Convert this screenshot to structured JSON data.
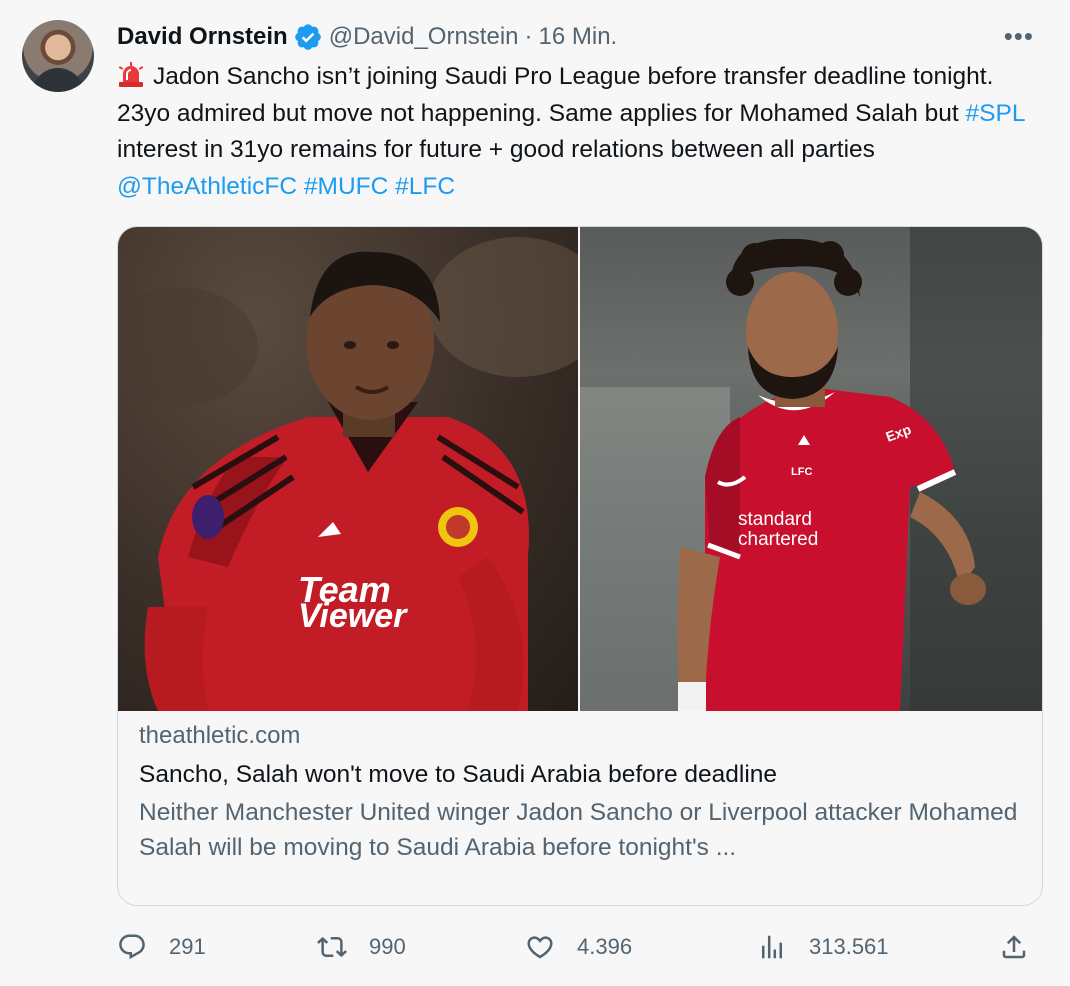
{
  "author": {
    "name": "David Ornstein",
    "handle": "@David_Ornstein",
    "separator": "·",
    "time": "16 Min."
  },
  "menu": {
    "more_label": "•••"
  },
  "tweet": {
    "emoji_icon": "siren-icon",
    "text_part1": "Jadon Sancho isn’t joining Saudi Pro League before transfer deadline tonight. 23yo admired but move not happening. Same applies for Mohamed Salah but ",
    "hashtag_spl": "#SPL",
    "text_part2": " interest in 31yo remains for future + good relations between all parties ",
    "mention": "@TheAthleticFC",
    "hashtag_mufc": "#MUFC",
    "hashtag_lfc": "#LFC"
  },
  "card": {
    "domain": "theathletic.com",
    "title": "Sancho, Salah won't move to Saudi Arabia before deadline",
    "description": "Neither Manchester United winger Jadon Sancho or Liverpool attacker Mohamed Salah will be moving to Saudi Arabia before tonight's ...",
    "left_photo": {
      "shirt_sponsor_line1": "Team",
      "shirt_sponsor_line2": "Viewer",
      "accent": "#b3161f"
    },
    "right_photo": {
      "shirt_sponsor_line1": "standard",
      "shirt_sponsor_line2": "chartered",
      "crest_text": "LFC",
      "sleeve_text": "Exp",
      "accent": "#c8102e"
    }
  },
  "actions": {
    "replies": "291",
    "retweets": "990",
    "likes": "4.396",
    "views": "313.561"
  },
  "colors": {
    "background": "#f7f7f7",
    "link": "#1d9bf0",
    "secondary_text": "#536471",
    "verified": "#1d9bf0"
  }
}
